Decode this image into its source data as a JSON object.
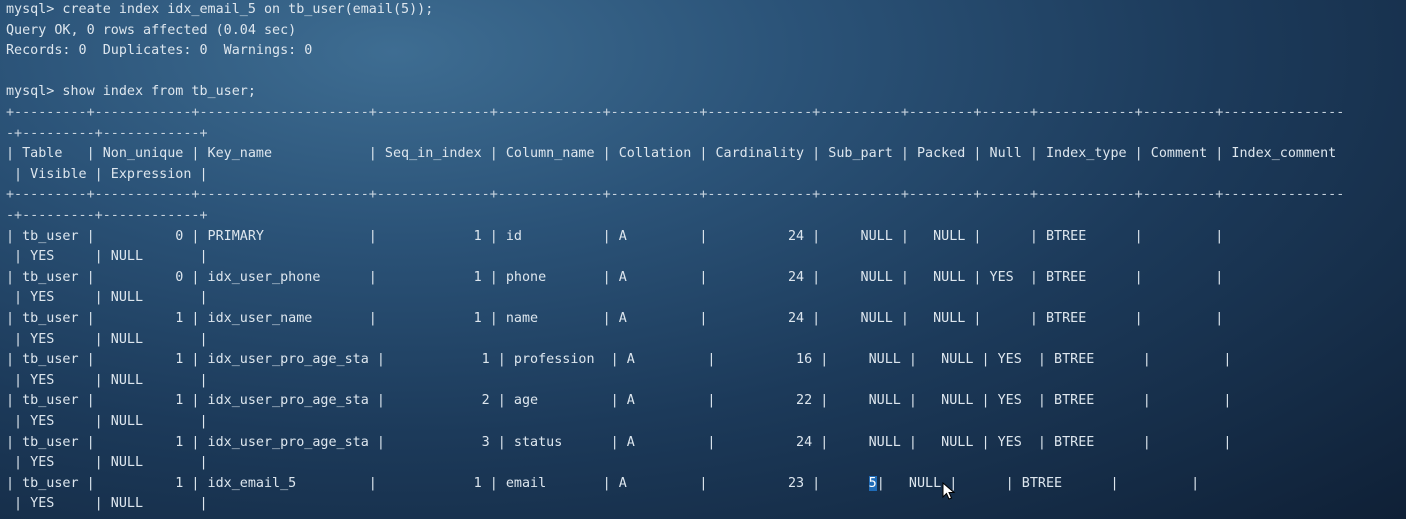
{
  "colors": {
    "background": "#1c3a5a",
    "text": "#dde6ee",
    "highlight": "#1f6bb6"
  },
  "terminal": {
    "lines": [
      "mysql> create index idx_email_5 on tb_user(email(5));",
      "Query OK, 0 rows affected (0.04 sec)",
      "Records: 0  Duplicates: 0  Warnings: 0",
      "",
      "mysql> show index from tb_user;",
      "+---------+------------+---------------------+--------------+-------------+-----------+-------------+----------+--------+------+------------+---------+---------------",
      "-+---------+------------+",
      "| Table   | Non_unique | Key_name            | Seq_in_index | Column_name | Collation | Cardinality | Sub_part | Packed | Null | Index_type | Comment | Index_comment",
      " | Visible | Expression |",
      "+---------+------------+---------------------+--------------+-------------+-----------+-------------+----------+--------+------+------------+---------+---------------",
      "-+---------+------------+",
      "| tb_user |          0 | PRIMARY             |            1 | id          | A         |          24 |     NULL |   NULL |      | BTREE      |         |",
      " | YES     | NULL       |",
      "| tb_user |          0 | idx_user_phone      |            1 | phone       | A         |          24 |     NULL |   NULL | YES  | BTREE      |         |",
      " | YES     | NULL       |",
      "| tb_user |          1 | idx_user_name       |            1 | name        | A         |          24 |     NULL |   NULL |      | BTREE      |         |",
      " | YES     | NULL       |",
      "| tb_user |          1 | idx_user_pro_age_sta |            1 | profession  | A         |          16 |     NULL |   NULL | YES  | BTREE      |         |",
      " | YES     | NULL       |",
      "| tb_user |          1 | idx_user_pro_age_sta |            2 | age         | A         |          22 |     NULL |   NULL | YES  | BTREE      |         |",
      " | YES     | NULL       |",
      "| tb_user |          1 | idx_user_pro_age_sta |            3 | status      | A         |          24 |     NULL |   NULL | YES  | BTREE      |         |",
      " | YES     | NULL       |",
      "| tb_user |          1 | idx_email_5         |            1 | email       | A         |          23 |",
      " | YES     | NULL       |"
    ],
    "highlighted_value": "5",
    "last_row_tail": "|   NULL |      | BTREE      |         |"
  }
}
